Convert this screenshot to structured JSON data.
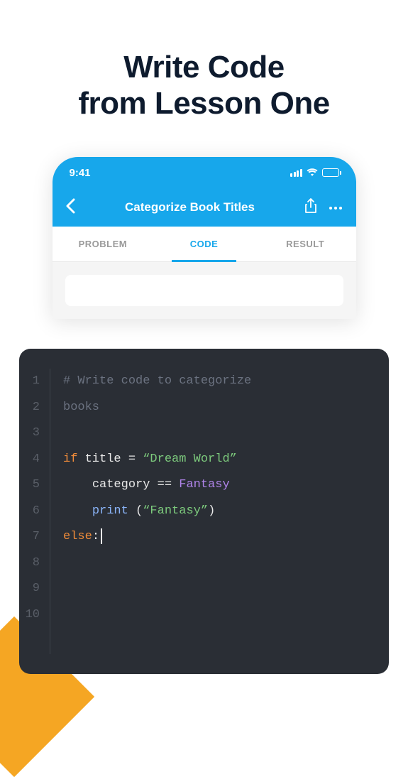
{
  "headline_line1": "Write Code",
  "headline_line2": "from Lesson One",
  "statusbar": {
    "time": "9:41"
  },
  "nav": {
    "title": "Categorize Book Titles"
  },
  "tabs": [
    {
      "label": "PROBLEM",
      "active": false
    },
    {
      "label": "CODE",
      "active": true
    },
    {
      "label": "RESULT",
      "active": false
    }
  ],
  "code": {
    "line_numbers": [
      "1",
      "2",
      "3",
      "4",
      "5",
      "6",
      "7",
      "8",
      "9",
      "10"
    ],
    "lines": [
      {
        "tokens": [
          {
            "text": "# Write code to categorize",
            "cls": "tok-comment"
          }
        ]
      },
      {
        "tokens": [
          {
            "text": "books",
            "cls": "tok-comment"
          }
        ],
        "continuation": true
      },
      {
        "tokens": []
      },
      {
        "tokens": [
          {
            "text": "if ",
            "cls": "tok-keyword"
          },
          {
            "text": "title ",
            "cls": "tok-ident"
          },
          {
            "text": "= ",
            "cls": "tok-op"
          },
          {
            "text": "“Dream World”",
            "cls": "tok-string"
          }
        ]
      },
      {
        "indent": 1,
        "tokens": [
          {
            "text": "category ",
            "cls": "tok-ident"
          },
          {
            "text": "== ",
            "cls": "tok-op"
          },
          {
            "text": "Fantasy",
            "cls": "tok-name"
          }
        ]
      },
      {
        "indent": 1,
        "tokens": [
          {
            "text": "print ",
            "cls": "tok-func"
          },
          {
            "text": "(",
            "cls": "tok-op"
          },
          {
            "text": "“Fantasy”",
            "cls": "tok-string"
          },
          {
            "text": ")",
            "cls": "tok-op"
          }
        ]
      },
      {
        "tokens": [
          {
            "text": "else",
            "cls": "tok-keyword"
          },
          {
            "text": ":",
            "cls": "tok-op"
          }
        ],
        "cursor": true
      },
      {
        "tokens": []
      },
      {
        "tokens": []
      },
      {
        "tokens": []
      },
      {
        "tokens": []
      }
    ]
  }
}
